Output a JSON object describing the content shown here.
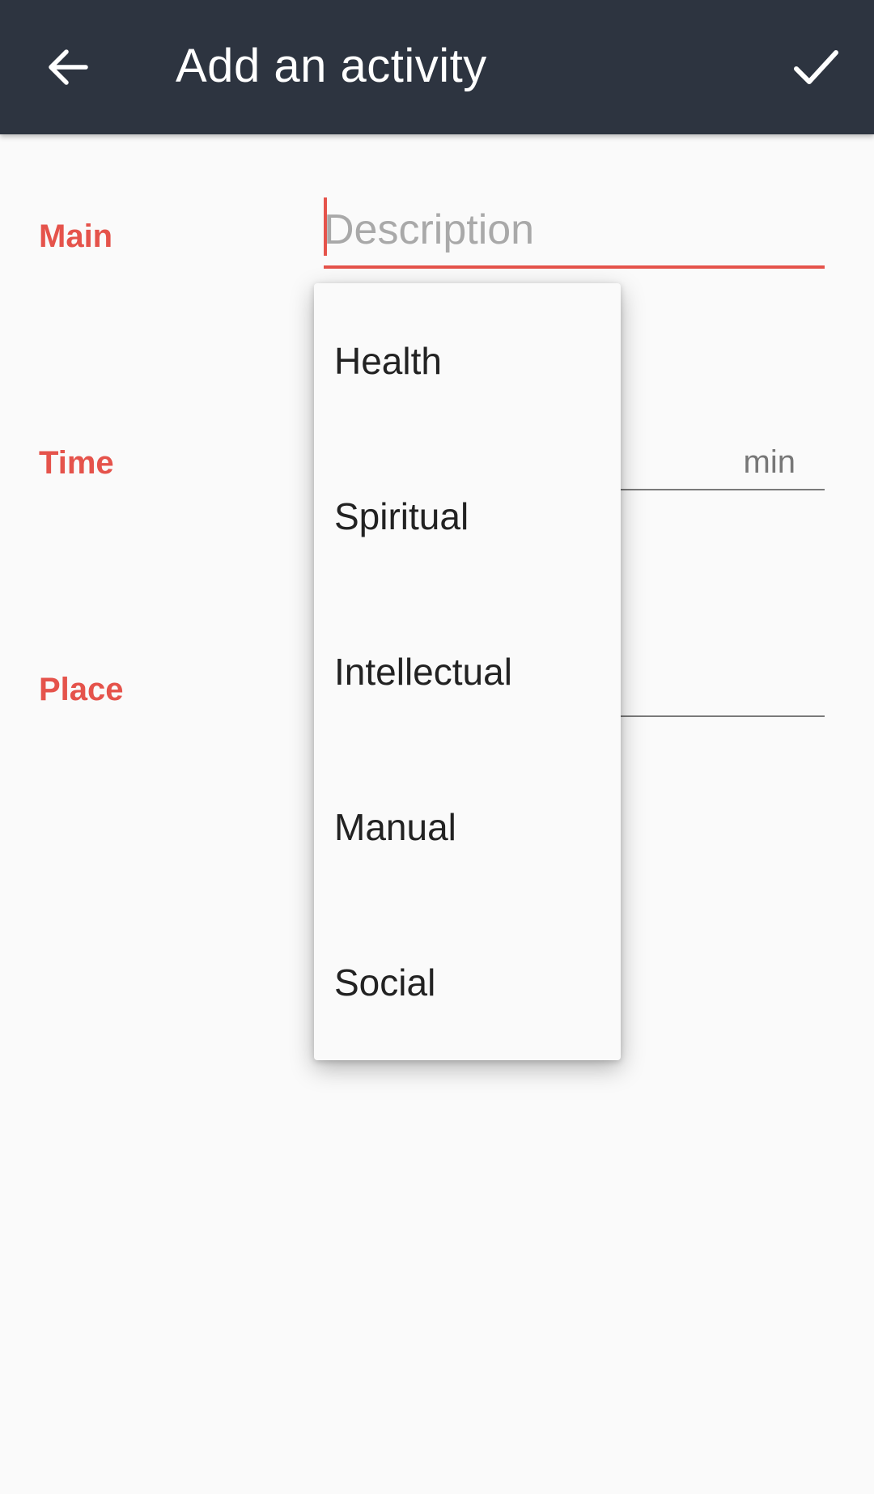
{
  "header": {
    "title": "Add an activity",
    "back_icon": "arrow-left-icon",
    "confirm_icon": "checkmark-icon"
  },
  "form": {
    "main": {
      "label": "Main",
      "description_placeholder": "Description",
      "description_value": ""
    },
    "time": {
      "label": "Time",
      "unit": "min"
    },
    "place": {
      "label": "Place"
    }
  },
  "dropdown": {
    "items": [
      {
        "label": "Health"
      },
      {
        "label": "Spiritual"
      },
      {
        "label": "Intellectual"
      },
      {
        "label": "Manual"
      },
      {
        "label": "Social"
      }
    ]
  },
  "colors": {
    "app_bar": "#2d3440",
    "accent": "#e5534b",
    "background": "#fafafa"
  }
}
